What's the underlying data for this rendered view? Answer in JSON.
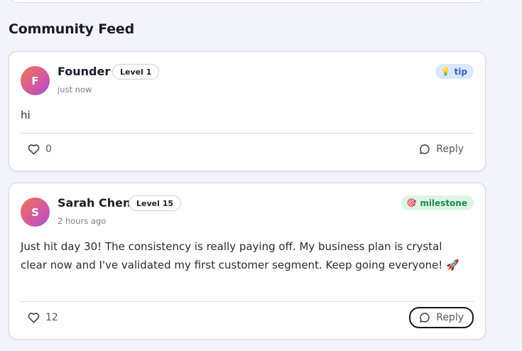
{
  "feed": {
    "title": "Community Feed"
  },
  "posts": [
    {
      "avatar_initial": "F",
      "author": "Founder",
      "level": "Level 1",
      "timestamp": "just now",
      "tag": {
        "label": "tip",
        "icon": "lightbulb-icon",
        "glyph": "💡"
      },
      "body": "hi",
      "likes": "0",
      "reply_label": "Reply"
    },
    {
      "avatar_initial": "S",
      "author": "Sarah Chen",
      "level": "Level 15",
      "timestamp": "2 hours ago",
      "tag": {
        "label": "milestone",
        "icon": "target-icon",
        "glyph": "🎯"
      },
      "body": "Just hit day 30! The consistency is really paying off. My business plan is crystal clear now and I've validated my first customer segment. Keep going everyone! 🚀",
      "likes": "12",
      "reply_label": "Reply"
    }
  ],
  "colors": {
    "background": "#f3f4fb",
    "tip_bg": "#dbe7fb",
    "tip_text": "#3a62c9",
    "milestone_bg": "#dcf6e6",
    "milestone_text": "#1f8a4f"
  }
}
